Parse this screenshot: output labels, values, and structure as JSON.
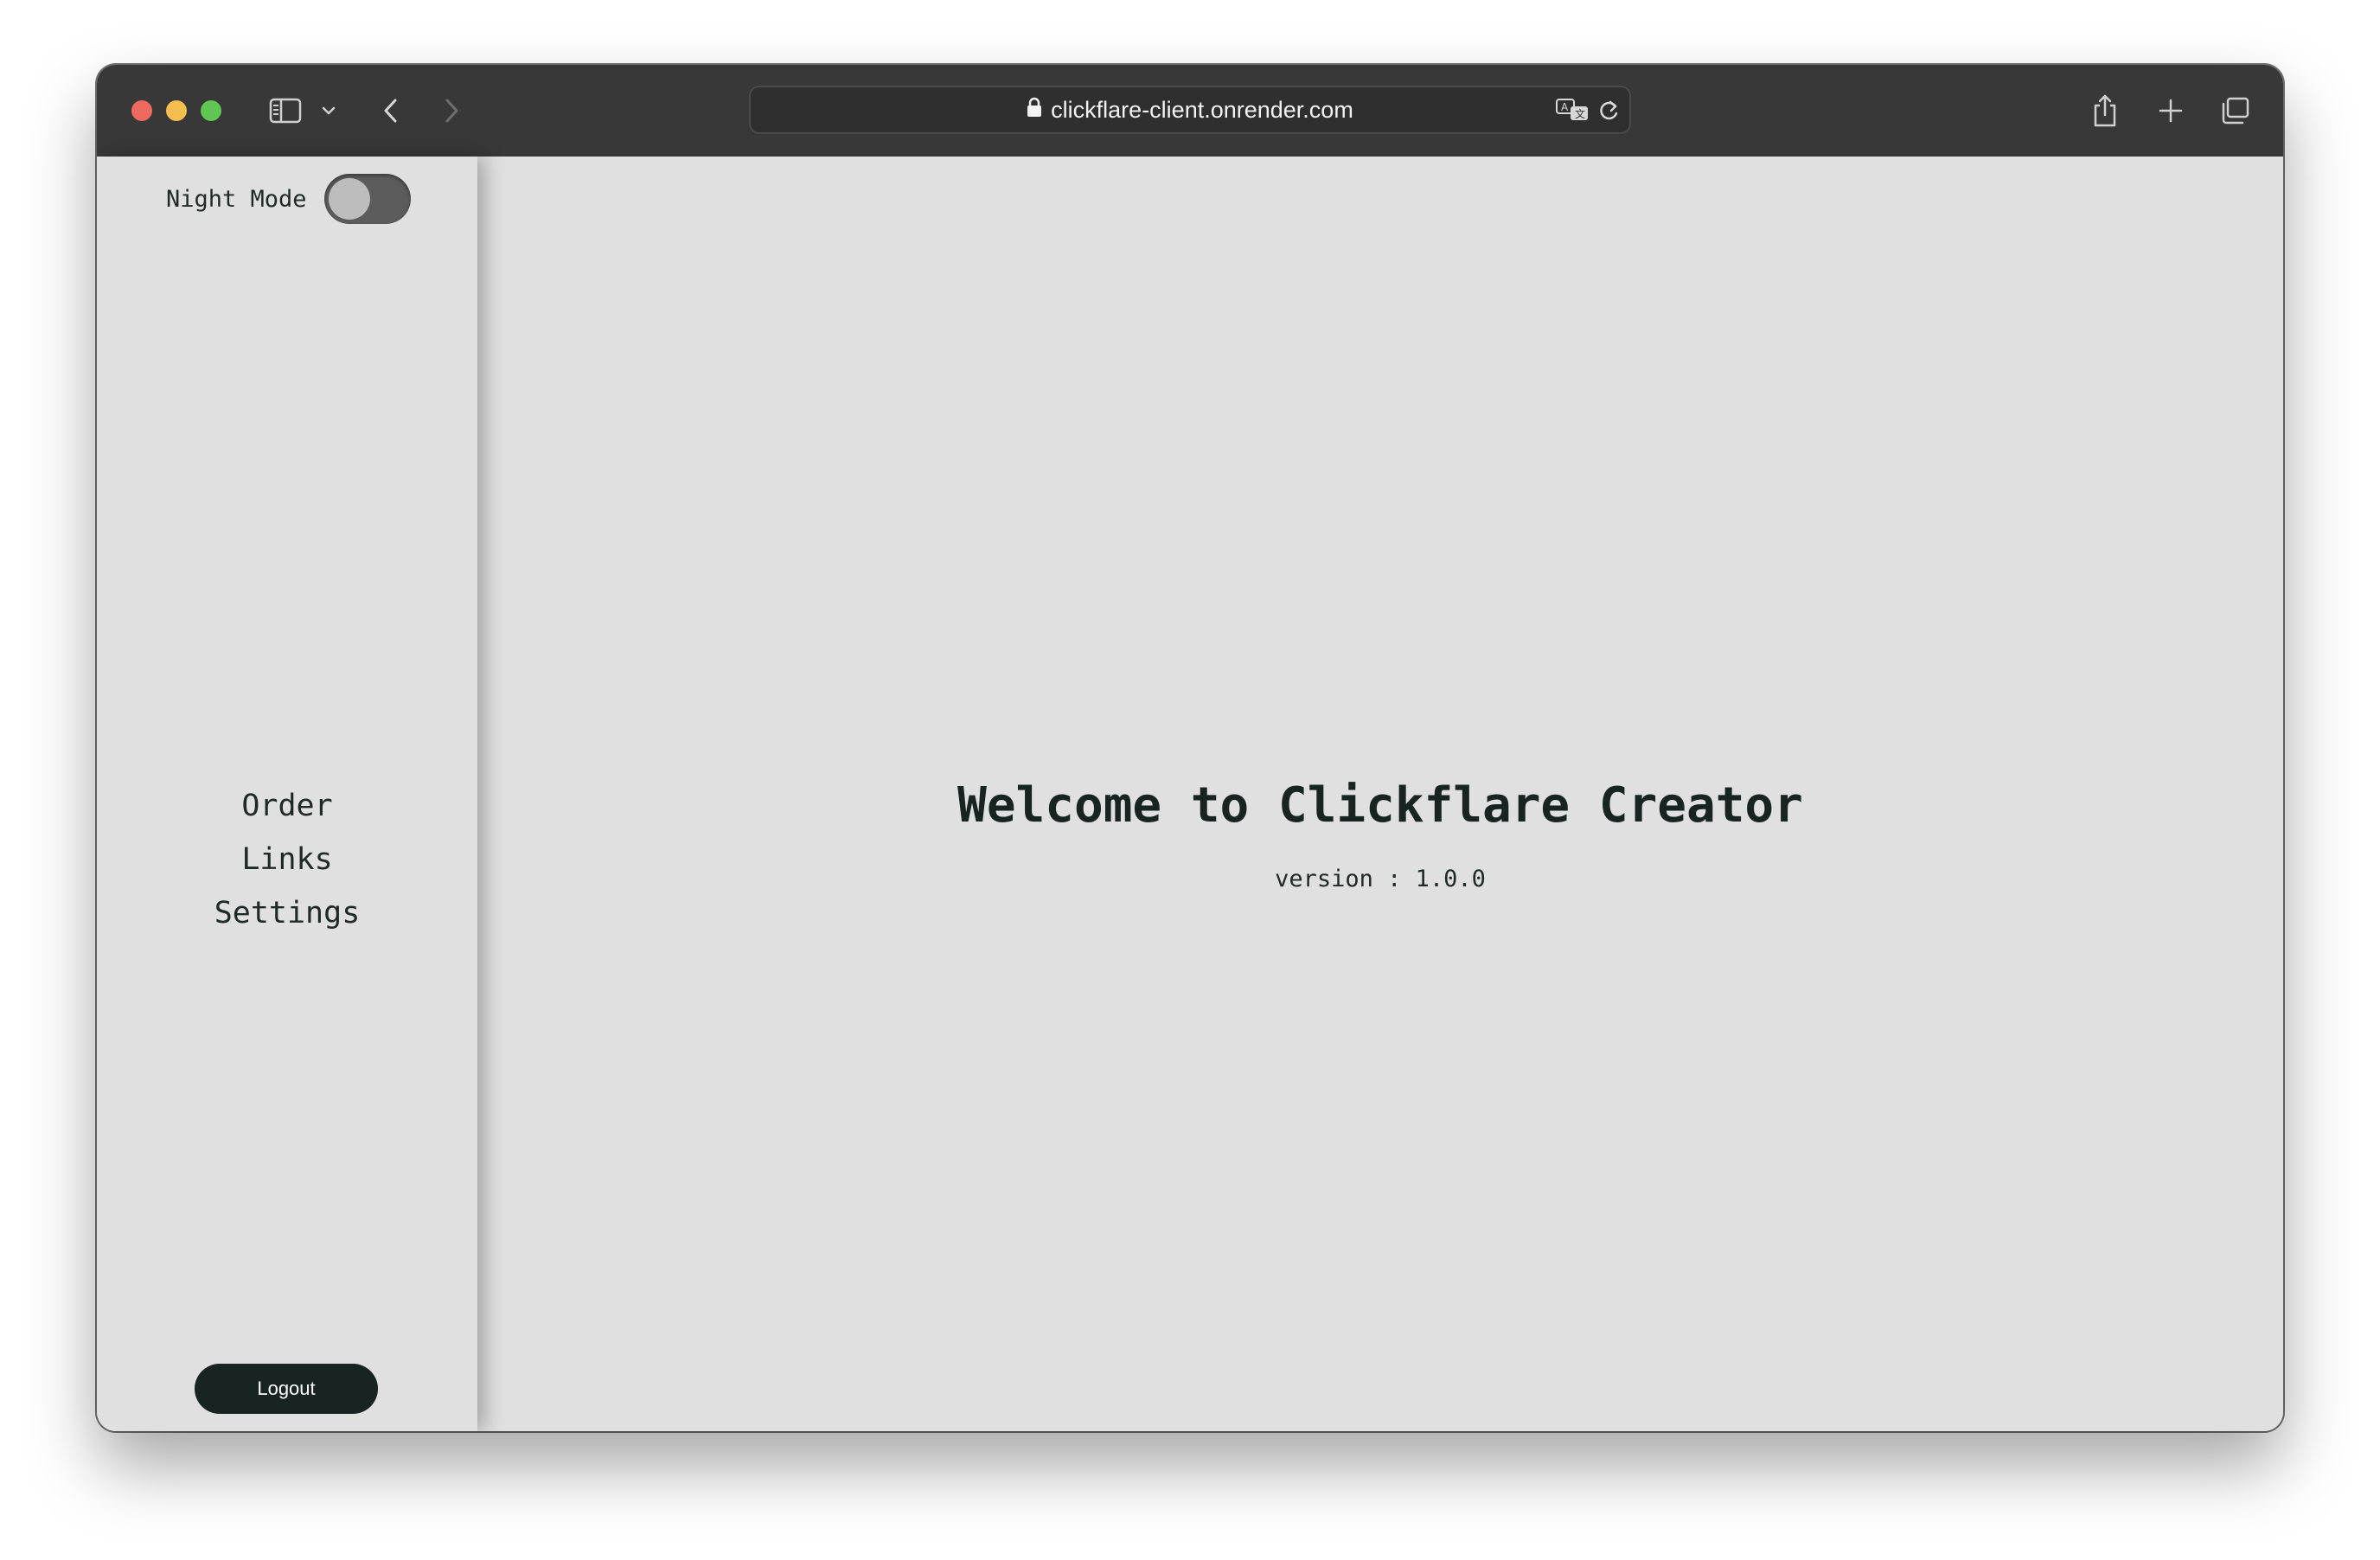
{
  "browser": {
    "url": "clickflare-client.onrender.com"
  },
  "sidebar": {
    "night_mode_label": "Night Mode",
    "night_mode_on": false,
    "nav_items": [
      {
        "label": "Order"
      },
      {
        "label": "Links"
      },
      {
        "label": "Settings"
      }
    ],
    "logout_label": "Logout"
  },
  "main": {
    "title": "Welcome to Clickflare Creator",
    "version": "version : 1.0.0"
  },
  "colors": {
    "background": "#dfe0df",
    "text": "#172422",
    "logout_button": "#172422",
    "titlebar": "#383838"
  }
}
